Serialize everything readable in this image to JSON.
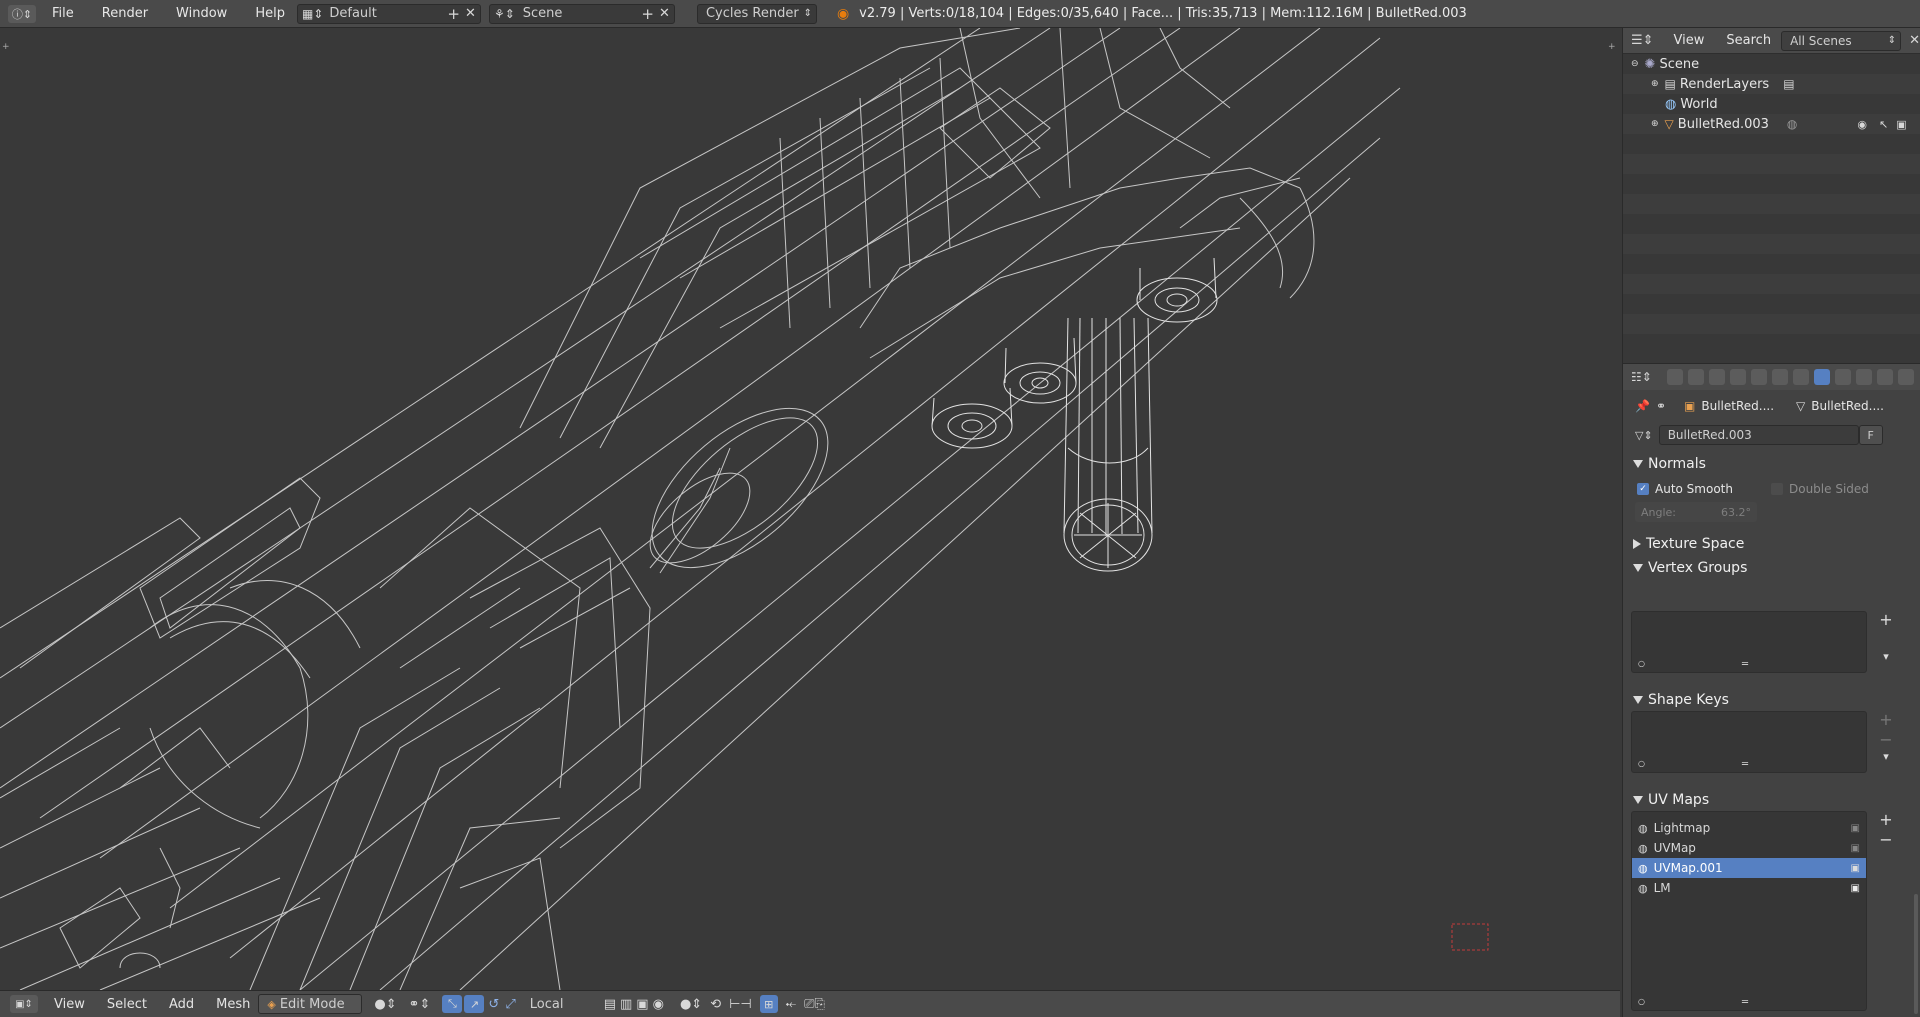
{
  "topbar": {
    "menus": [
      "File",
      "Render",
      "Window",
      "Help"
    ],
    "screen_layout": "Default",
    "scene": "Scene",
    "render_engine": "Cycles Render",
    "stats": "v2.79 | Verts:0/18,104 | Edges:0/35,640 | Face... | Tris:35,713 | Mem:112.16M | BulletRed.003"
  },
  "bottombar": {
    "menus": [
      "View",
      "Select",
      "Add",
      "Mesh"
    ],
    "mode": "Edit Mode",
    "pivot": "Local"
  },
  "outliner": {
    "view_label": "View",
    "search_label": "Search",
    "filter": "All Scenes",
    "items": [
      {
        "label": "Scene",
        "icon": "scene-icon"
      },
      {
        "label": "RenderLayers",
        "icon": "renderlayers-icon"
      },
      {
        "label": "World",
        "icon": "world-icon"
      },
      {
        "label": "BulletRed.003",
        "icon": "mesh-icon"
      }
    ]
  },
  "properties": {
    "breadcrumb_object": "BulletRed....",
    "breadcrumb_data": "BulletRed....",
    "data_name": "BulletRed.003",
    "fake_user": "F",
    "normals": {
      "title": "Normals",
      "auto_smooth": "Auto Smooth",
      "auto_smooth_checked": true,
      "double_sided": "Double Sided",
      "angle_label": "Angle:",
      "angle_value": "63.2°"
    },
    "texture_space": "Texture Space",
    "vertex_groups": "Vertex Groups",
    "shape_keys": "Shape Keys",
    "uv_maps": {
      "title": "UV Maps",
      "items": [
        "Lightmap",
        "UVMap",
        "UVMap.001",
        "LM"
      ],
      "selected": "UVMap.001"
    }
  },
  "colors": {
    "accent": "#5680c2",
    "background": "#393939",
    "wire": "#d9d9d9"
  }
}
